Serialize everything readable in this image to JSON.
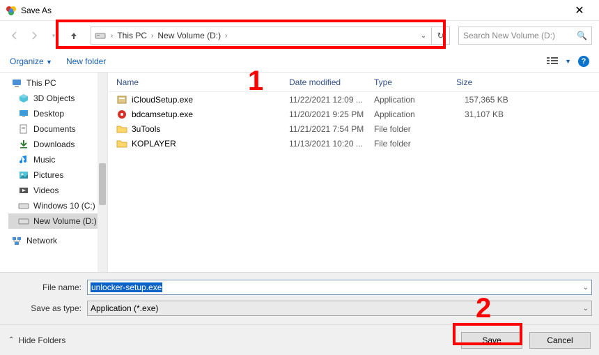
{
  "window": {
    "title": "Save As"
  },
  "breadcrumb": {
    "root": "This PC",
    "folder": "New Volume (D:)"
  },
  "search": {
    "placeholder": "Search New Volume (D:)"
  },
  "toolbar": {
    "organize": "Organize",
    "new_folder": "New folder"
  },
  "columns": {
    "name": "Name",
    "date": "Date modified",
    "type": "Type",
    "size": "Size"
  },
  "tree": {
    "root": "This PC",
    "items": [
      "3D Objects",
      "Desktop",
      "Documents",
      "Downloads",
      "Music",
      "Pictures",
      "Videos",
      "Windows 10 (C:)",
      "New Volume (D:)"
    ],
    "network": "Network"
  },
  "files": [
    {
      "name": "iCloudSetup.exe",
      "date": "11/22/2021 12:09 ...",
      "type": "Application",
      "size": "157,365 KB",
      "icon": "box"
    },
    {
      "name": "bdcamsetup.exe",
      "date": "11/20/2021 9:25 PM",
      "type": "Application",
      "size": "31,107 KB",
      "icon": "red"
    },
    {
      "name": "3uTools",
      "date": "11/21/2021 7:54 PM",
      "type": "File folder",
      "size": "",
      "icon": "folder"
    },
    {
      "name": "KOPLAYER",
      "date": "11/13/2021 10:20 ...",
      "type": "File folder",
      "size": "",
      "icon": "folder"
    }
  ],
  "form": {
    "file_name_label": "File name:",
    "file_name_value": "unlocker-setup.exe",
    "save_type_label": "Save as type:",
    "save_type_value": "Application (*.exe)"
  },
  "footer": {
    "hide_folders": "Hide Folders",
    "save": "Save",
    "cancel": "Cancel"
  },
  "annotations": {
    "one": "1",
    "two": "2"
  }
}
